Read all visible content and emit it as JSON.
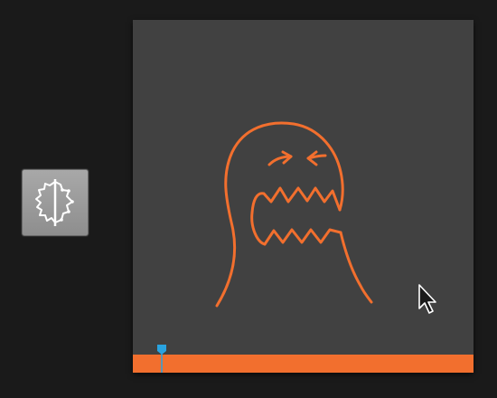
{
  "toolbar": {
    "tool_icon": "mirror-symmetry-icon",
    "tool_background": "#9b9b9b"
  },
  "canvas": {
    "background": "#414141",
    "stroke_color": "#f26f2e",
    "drawing": "ghost-monster-sketch"
  },
  "timeline": {
    "bar_color": "#f26f2e",
    "playhead_color": "#29a3e0",
    "playhead_position": 0.08
  },
  "cursor": {
    "icon": "arrow-cursor-icon"
  }
}
